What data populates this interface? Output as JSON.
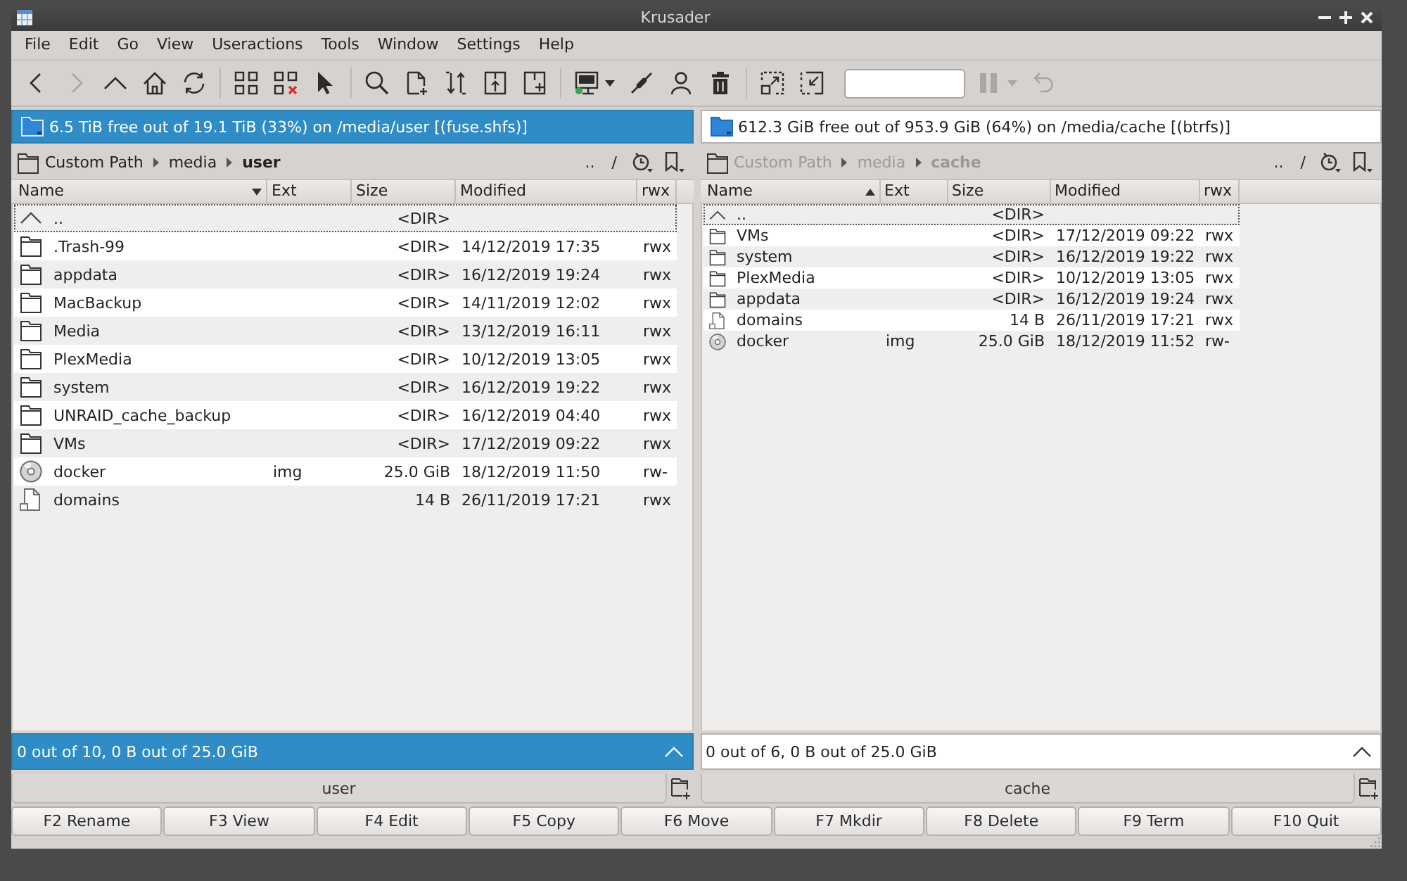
{
  "window": {
    "title": "Krusader"
  },
  "menu": [
    "File",
    "Edit",
    "Go",
    "View",
    "Useractions",
    "Tools",
    "Window",
    "Settings",
    "Help"
  ],
  "toolbar": [
    {
      "kind": "button",
      "disabled": false
    },
    {
      "kind": "button",
      "disabled": true
    },
    {
      "kind": "button",
      "disabled": false
    },
    {
      "kind": "button",
      "disabled": false
    },
    {
      "kind": "button",
      "disabled": false
    },
    {
      "kind": "separator"
    },
    {
      "kind": "button",
      "disabled": false
    },
    {
      "kind": "button",
      "disabled": false
    },
    {
      "kind": "button",
      "disabled": false
    },
    {
      "kind": "separator"
    },
    {
      "kind": "button",
      "disabled": false
    },
    {
      "kind": "button",
      "disabled": false
    },
    {
      "kind": "button",
      "disabled": false
    },
    {
      "kind": "button",
      "disabled": false
    },
    {
      "kind": "button",
      "disabled": false
    },
    {
      "kind": "separator"
    },
    {
      "kind": "menu-button",
      "disabled": false
    },
    {
      "kind": "button",
      "disabled": false
    },
    {
      "kind": "button",
      "disabled": false
    },
    {
      "kind": "button",
      "disabled": false
    },
    {
      "kind": "separator"
    },
    {
      "kind": "button",
      "disabled": false
    },
    {
      "kind": "button",
      "disabled": false
    },
    {
      "kind": "field"
    },
    {
      "kind": "menu-button",
      "disabled": true
    },
    {
      "kind": "button",
      "disabled": true
    }
  ],
  "panels": [
    {
      "active": true,
      "disk_info": "6.5 TiB free out of 19.1 TiB (33%) on /media/user [(fuse.shfs)]",
      "breadcrumb": [
        "Custom Path",
        "media",
        "user"
      ],
      "path_buttons": [
        "..",
        "/"
      ],
      "columns": [
        {
          "label": "Name",
          "sorted": true,
          "ascending": true
        },
        {
          "label": "Ext",
          "sorted": false
        },
        {
          "label": "Size",
          "sorted": false
        },
        {
          "label": "Modified",
          "sorted": false
        },
        {
          "label": "rwx",
          "sorted": false
        }
      ],
      "rows": [
        {
          "kind": "parent",
          "name": "..",
          "size": "<DIR>",
          "focused": true
        },
        {
          "kind": "folder",
          "name": ".Trash-99",
          "size": "<DIR>",
          "modified": "14/12/2019 17:35",
          "rwx": "rwx",
          "focused": false
        },
        {
          "kind": "folder",
          "name": "appdata",
          "size": "<DIR>",
          "modified": "16/12/2019 19:24",
          "rwx": "rwx",
          "focused": false
        },
        {
          "kind": "folder",
          "name": "MacBackup",
          "size": "<DIR>",
          "modified": "14/11/2019 12:02",
          "rwx": "rwx",
          "focused": false
        },
        {
          "kind": "folder",
          "name": "Media",
          "size": "<DIR>",
          "modified": "13/12/2019 16:11",
          "rwx": "rwx",
          "focused": false
        },
        {
          "kind": "folder",
          "name": "PlexMedia",
          "size": "<DIR>",
          "modified": "10/12/2019 13:05",
          "rwx": "rwx",
          "focused": false
        },
        {
          "kind": "folder",
          "name": "system",
          "size": "<DIR>",
          "modified": "16/12/2019 19:22",
          "rwx": "rwx",
          "focused": false
        },
        {
          "kind": "folder",
          "name": "UNRAID_cache_backup",
          "size": "<DIR>",
          "modified": "16/12/2019 04:40",
          "rwx": "rwx",
          "focused": false
        },
        {
          "kind": "folder",
          "name": "VMs",
          "size": "<DIR>",
          "modified": "17/12/2019 09:22",
          "rwx": "rwx",
          "focused": false
        },
        {
          "kind": "disk-image",
          "name": "docker",
          "ext": "img",
          "size": "25.0 GiB",
          "modified": "18/12/2019 11:50",
          "rwx": "rw-",
          "focused": false
        },
        {
          "kind": "file",
          "name": "domains",
          "size": "14 B",
          "modified": "26/11/2019 17:21",
          "rwx": "rwx",
          "focused": false
        }
      ],
      "status": "0 out of 10, 0 B out of 25.0 GiB",
      "tab": "user"
    },
    {
      "active": false,
      "disk_info": "612.3 GiB free out of 953.9 GiB (64%) on /media/cache [(btrfs)]",
      "breadcrumb": [
        "Custom Path",
        "media",
        "cache"
      ],
      "path_buttons": [
        "..",
        "/"
      ],
      "columns": [
        {
          "label": "Name",
          "sorted": true,
          "ascending": false
        },
        {
          "label": "Ext",
          "sorted": false
        },
        {
          "label": "Size",
          "sorted": false
        },
        {
          "label": "Modified",
          "sorted": false
        },
        {
          "label": "rwx",
          "sorted": false
        }
      ],
      "rows": [
        {
          "kind": "parent",
          "name": "..",
          "size": "<DIR>",
          "focused": true
        },
        {
          "kind": "folder",
          "name": "VMs",
          "size": "<DIR>",
          "modified": "17/12/2019 09:22",
          "rwx": "rwx",
          "focused": false
        },
        {
          "kind": "folder",
          "name": "system",
          "size": "<DIR>",
          "modified": "16/12/2019 19:22",
          "rwx": "rwx",
          "focused": false
        },
        {
          "kind": "folder",
          "name": "PlexMedia",
          "size": "<DIR>",
          "modified": "10/12/2019 13:05",
          "rwx": "rwx",
          "focused": false
        },
        {
          "kind": "folder",
          "name": "appdata",
          "size": "<DIR>",
          "modified": "16/12/2019 19:24",
          "rwx": "rwx",
          "focused": false
        },
        {
          "kind": "file",
          "name": "domains",
          "size": "14 B",
          "modified": "26/11/2019 17:21",
          "rwx": "rwx",
          "focused": false
        },
        {
          "kind": "disk-image",
          "name": "docker",
          "ext": "img",
          "size": "25.0 GiB",
          "modified": "18/12/2019 11:52",
          "rwx": "rw-",
          "focused": false
        }
      ],
      "status": "0 out of 6, 0 B out of 25.0 GiB",
      "tab": "cache"
    }
  ],
  "function_keys": [
    "F2 Rename",
    "F3 View",
    "F4 Edit",
    "F5 Copy",
    "F6 Move",
    "F7 Mkdir",
    "F8 Delete",
    "F9 Term",
    "F10 Quit"
  ]
}
